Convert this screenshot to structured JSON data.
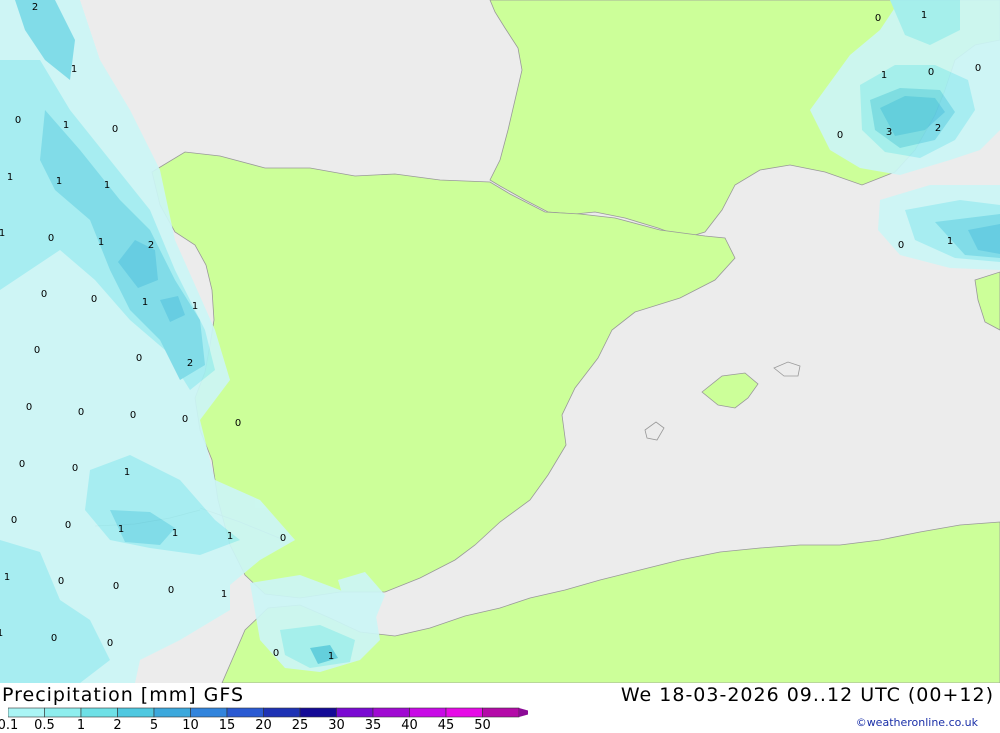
{
  "footer": {
    "title": "Precipitation [mm] GFS",
    "datetime": "We 18-03-2026 09..12 UTC (00+12)",
    "credit": "©weatheronline.co.uk"
  },
  "legend": {
    "ticks": [
      "0.1",
      "0.5",
      "1",
      "2",
      "5",
      "10",
      "15",
      "20",
      "25",
      "30",
      "35",
      "40",
      "45",
      "50"
    ],
    "colors": [
      "#aaf5f5",
      "#8eeeee",
      "#6ee0e6",
      "#4fc8e0",
      "#3ca8dc",
      "#3284dc",
      "#2a5ad2",
      "#1e32b4",
      "#140a96",
      "#7a0ad2",
      "#a00ad2",
      "#c80ae6",
      "#e60ae6",
      "#b40aa8",
      "#8c0a96"
    ]
  },
  "colors": {
    "sea": "#ececec",
    "land": "#ccff99",
    "precip_light": "#ccf6f6",
    "precip_1": "#a2eef2",
    "precip_2": "#79dbe8",
    "precip_3": "#5ccbe2"
  },
  "map_labels": [
    "2",
    "1",
    "0",
    "1",
    "0",
    "1",
    "1",
    "1",
    "1",
    "0",
    "1",
    "2",
    "0",
    "0",
    "1",
    "1",
    "0",
    "2",
    "0",
    "0",
    "0",
    "0",
    "0",
    "0",
    "0",
    "0",
    "1",
    "0",
    "0",
    "1",
    "1",
    "1",
    "0",
    "1",
    "0",
    "0",
    "0",
    "1",
    "0",
    "0",
    "1",
    "0",
    "1",
    "0",
    "0",
    "1",
    "0",
    "0",
    "3",
    "2",
    "0",
    "1",
    "1"
  ]
}
